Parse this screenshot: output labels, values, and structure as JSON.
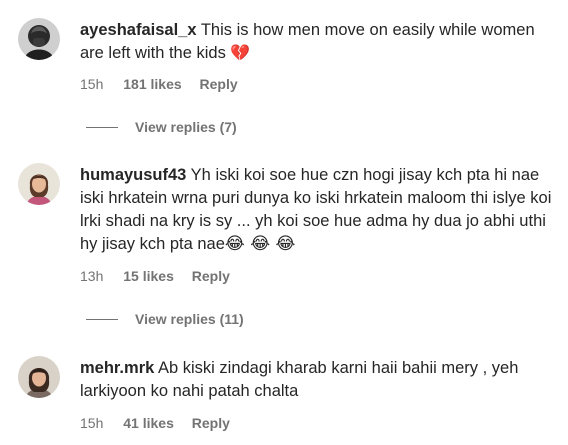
{
  "comments": [
    {
      "username": "ayeshafaisal_x",
      "text": "This is how men move on easily while women are left with the kids",
      "emoji": "💔",
      "time": "15h",
      "likes": "181 likes",
      "reply": "Reply",
      "view_replies": "View replies (7)"
    },
    {
      "username": "humayusuf43",
      "text": "Yh iski koi soe hue czn hogi jisay kch pta hi nae iski hrkatein wrna puri dunya ko iski hrkatein maloom thi islye koi lrki shadi na kry is sy ... yh koi soe hue adma hy dua jo abhi uthi hy jisay kch pta nae",
      "emoji": "😂 😂 😂",
      "time": "13h",
      "likes": "15 likes",
      "reply": "Reply",
      "view_replies": "View replies (11)"
    },
    {
      "username": "mehr.mrk",
      "text": "Ab kiski zindagi kharab karni haii bahii mery , yeh larkiyoon ko nahi patah chalta",
      "time": "15h",
      "likes": "41 likes",
      "reply": "Reply"
    }
  ],
  "icons": {
    "broken_heart": "broken-heart-icon",
    "laugh": "face-with-tears-of-joy-icon"
  },
  "colors": {
    "text": "#262626",
    "secondary": "#737373",
    "heart": "#e0245e"
  }
}
